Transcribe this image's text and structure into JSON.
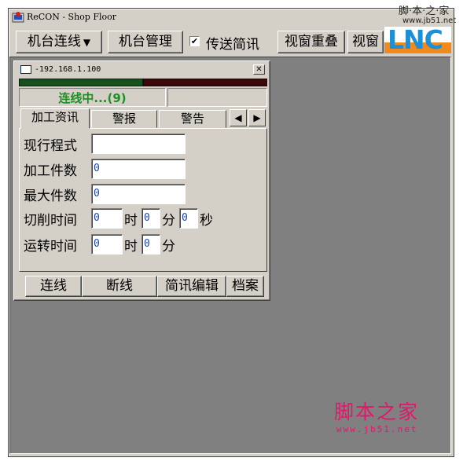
{
  "window": {
    "title": "ReCON - Shop Floor"
  },
  "watermark": {
    "top_cn": "脚·本·之·家",
    "top_url": "www.jb51.net",
    "bottom_cn": "脚本之家",
    "bottom_url": "www.jb51.net"
  },
  "toolbar": {
    "connect_label": "机台连线",
    "manage_label": "机台管理",
    "send_check_mark": "✔",
    "send_label": "传送简讯",
    "cascade_label": "视窗重叠",
    "window_label": "视窗",
    "logo_text": "LNC"
  },
  "child": {
    "title": "-192.168.1.100",
    "close_glyph": "✕",
    "connection_progress": 0.5,
    "status": "连线中...(9)",
    "tabs": [
      {
        "label": "加工资讯",
        "active": true
      },
      {
        "label": "警报",
        "active": false
      },
      {
        "label": "警告",
        "active": false
      }
    ],
    "tab_prev": "◀",
    "tab_next": "▶",
    "fields": {
      "program_label": "现行程式",
      "program_value": "",
      "count_label": "加工件数",
      "count_value": "0",
      "max_label": "最大件数",
      "max_value": "0",
      "cut_label": "切削时间",
      "cut_hour": "0",
      "cut_min": "0",
      "cut_sec": "0",
      "run_label": "运转时间",
      "run_hour": "0",
      "run_min": "0",
      "unit_hour": "时",
      "unit_min": "分",
      "unit_sec": "秒"
    },
    "buttons": {
      "connect": "连线",
      "disconnect": "断线",
      "msg_edit": "简讯编辑",
      "file": "档案"
    }
  },
  "colors": {
    "status_text": "#1e8f24",
    "progress_done": "#16501d",
    "progress_remaining": "#3a0808",
    "workspace": "#808080",
    "watermark": "#e0186c"
  }
}
